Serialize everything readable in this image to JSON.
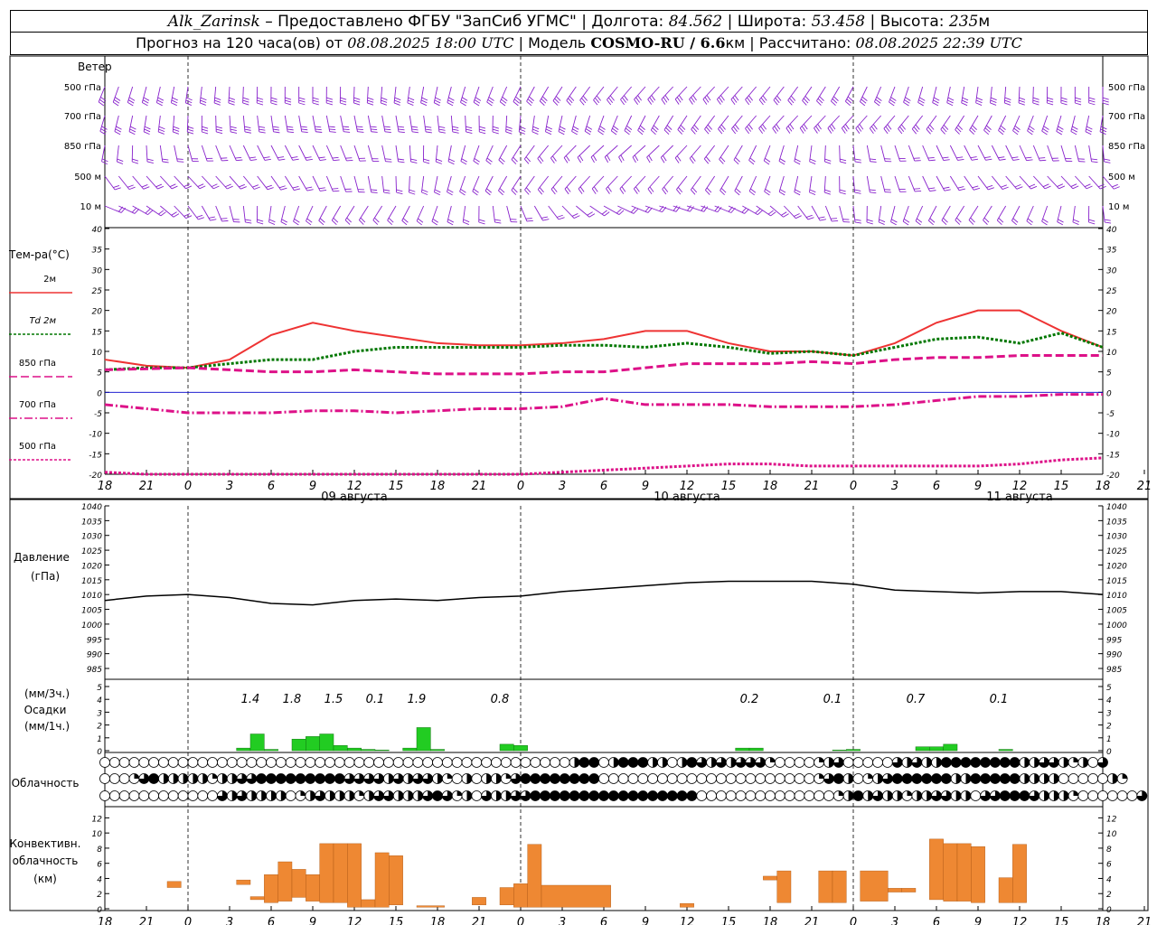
{
  "header": {
    "station": "Alk_Zarinsk",
    "provider": "– Предоставлено ФГБУ \"ЗапСиб УГМС\"",
    "lon_label": "Долгота:",
    "lon": "84.562",
    "lat_label": "Широта:",
    "lat": "53.458",
    "alt_label": "Высота:",
    "alt": "235",
    "alt_unit": "м",
    "forecast_label": "Прогноз на 120 часа(ов) от",
    "forecast_time": "08.08.2025 18:00 UTC",
    "model_label": "Модель",
    "model": "COSMO-RU / 6.6",
    "model_unit": "км",
    "calc_label": "Рассчитано:",
    "calc_time": "08.08.2025 22:39 UTC"
  },
  "colors": {
    "t2m": "#ee3333",
    "td2m": "#007700",
    "t850": "#dd1188",
    "t700": "#dd1188",
    "t500": "#dd1188",
    "wind": "#8822cc",
    "precip": "#22cc22",
    "convective": "#ee8833",
    "pressure": "#000000",
    "zero_line": "#0000cc"
  },
  "wind_panel": {
    "title": "Ветер",
    "levels": [
      "500 гПа",
      "700 гПа",
      "850 гПа",
      "500 м",
      "10 м"
    ]
  },
  "time_axis": {
    "tick_labels": [
      "18",
      "21",
      "0",
      "3",
      "6",
      "9",
      "12",
      "15",
      "18",
      "21",
      "0",
      "3",
      "6",
      "9",
      "12",
      "15",
      "18",
      "21",
      "0",
      "3",
      "6",
      "9",
      "12",
      "15",
      "18",
      "21",
      "0"
    ],
    "day_labels": [
      "09 августа",
      "10 августа",
      "11 августа"
    ]
  },
  "temp_panel": {
    "title": "Тем-ра(°С)",
    "legend": [
      "2м",
      "Td  2м",
      "850 гПа",
      "700 гПа",
      "500 гПа"
    ],
    "ticks": [
      "40",
      "35",
      "30",
      "25",
      "20",
      "15",
      "10",
      "5",
      "0",
      "-5",
      "-10",
      "-15",
      "-20"
    ]
  },
  "pressure_panel": {
    "title": "Давление",
    "unit": "(гПа)",
    "ticks": [
      "1040",
      "1035",
      "1030",
      "1025",
      "1020",
      "1015",
      "1010",
      "1005",
      "1000",
      "995",
      "990",
      "985"
    ]
  },
  "precip_panel": {
    "unit3": "(мм/3ч.)",
    "title": "Осадки",
    "unit1": "(мм/1ч.)",
    "ticks": [
      "5",
      "4",
      "3",
      "2",
      "1",
      "0"
    ],
    "totals_3h": [
      {
        "h": 10.5,
        "label": "1.4"
      },
      {
        "h": 13.5,
        "label": "1.8"
      },
      {
        "h": 16.5,
        "label": "1.5"
      },
      {
        "h": 19.5,
        "label": "0.1"
      },
      {
        "h": 22.5,
        "label": "1.9"
      },
      {
        "h": 28.5,
        "label": "0.8"
      },
      {
        "h": 46.5,
        "label": "0.2"
      },
      {
        "h": 52.5,
        "label": "0.1"
      },
      {
        "h": 58.5,
        "label": "0.7"
      },
      {
        "h": 64.5,
        "label": "0.1"
      }
    ]
  },
  "cloud_panel": {
    "title": "Облачность"
  },
  "conv_panel": {
    "title1": "Конвективн.",
    "title2": "облачность",
    "unit": "(км)",
    "ticks": [
      "12",
      "10",
      "8",
      "6",
      "4",
      "2",
      "0"
    ]
  },
  "chart_data": [
    {
      "type": "line",
      "title": "Тем-ра(°С)",
      "x_unit": "hours from 08.08.2025 18:00 UTC",
      "ylim": [
        -20,
        40
      ],
      "series": [
        {
          "name": "2м",
          "x": [
            0,
            3,
            6,
            9,
            12,
            15,
            18,
            21,
            24,
            27,
            30,
            33,
            36,
            39,
            42,
            45,
            48,
            51,
            54,
            57,
            60,
            63,
            66,
            69,
            72
          ],
          "values": [
            8,
            6.5,
            6,
            8,
            14,
            17,
            15,
            13.5,
            12,
            11.5,
            11.5,
            12,
            13,
            15,
            15,
            12,
            10,
            10,
            9,
            12,
            17,
            20,
            20,
            15,
            11
          ]
        },
        {
          "name": "Td  2м",
          "x": [
            0,
            3,
            6,
            9,
            12,
            15,
            18,
            21,
            24,
            27,
            30,
            33,
            36,
            39,
            42,
            45,
            48,
            51,
            54,
            57,
            60,
            63,
            66,
            69,
            72
          ],
          "values": [
            5.5,
            6,
            6,
            7,
            8,
            8,
            10,
            11,
            11,
            11,
            11,
            11.5,
            11.5,
            11,
            12,
            11,
            9.5,
            10,
            9,
            11,
            13,
            13.5,
            12,
            14.5,
            11
          ]
        },
        {
          "name": "850 гПа",
          "x": [
            0,
            6,
            9,
            12,
            15,
            18,
            21,
            24,
            27,
            30,
            33,
            36,
            39,
            42,
            45,
            48,
            51,
            54,
            57,
            60,
            63,
            66,
            69,
            72
          ],
          "values": [
            5.5,
            6,
            5.5,
            5,
            5,
            5.5,
            5,
            4.5,
            4.5,
            4.5,
            5,
            5,
            6,
            7,
            7,
            7,
            7.5,
            7,
            8,
            8.5,
            8.5,
            9,
            9,
            9
          ]
        },
        {
          "name": "700 гПа",
          "x": [
            0,
            3,
            6,
            9,
            12,
            15,
            18,
            21,
            24,
            27,
            30,
            33,
            36,
            39,
            42,
            45,
            48,
            51,
            54,
            57,
            60,
            63,
            66,
            69,
            72
          ],
          "values": [
            -3,
            -4,
            -5,
            -5,
            -5,
            -4.5,
            -4.5,
            -5,
            -4.5,
            -4,
            -4,
            -3.5,
            -1.5,
            -3,
            -3,
            -3,
            -3.5,
            -3.5,
            -3.5,
            -3,
            -2,
            -1,
            -1,
            -0.5,
            -0.5
          ]
        },
        {
          "name": "500 гПа",
          "x": [
            0,
            3,
            30,
            33,
            36,
            39,
            42,
            45,
            48,
            51,
            54,
            57,
            60,
            63,
            66,
            69,
            72
          ],
          "values": [
            -19.5,
            -20,
            -20,
            -19.5,
            -19,
            -18.5,
            -18,
            -17.5,
            -17.5,
            -18,
            -18,
            -18,
            -18,
            -18,
            -17.5,
            -16.5,
            -16
          ]
        }
      ]
    },
    {
      "type": "line",
      "title": "Давление",
      "ylim": [
        985,
        1040
      ],
      "series": [
        {
          "name": "Давление",
          "x": [
            0,
            3,
            6,
            9,
            12,
            15,
            18,
            21,
            24,
            27,
            30,
            33,
            36,
            39,
            42,
            45,
            48,
            51,
            54,
            57,
            60,
            63,
            66,
            69,
            72
          ],
          "values": [
            1008,
            1009.5,
            1010,
            1009,
            1007,
            1006.5,
            1008,
            1008.5,
            1008,
            1009,
            1009.5,
            1011,
            1012,
            1013,
            1014,
            1014.5,
            1014.5,
            1014.5,
            1013.5,
            1011.5,
            1011,
            1010.5,
            1011,
            1011,
            1010
          ]
        }
      ]
    },
    {
      "type": "bar",
      "title": "Осадки",
      "unit": "мм/1ч.",
      "ylim": [
        0,
        5
      ],
      "x": [
        10,
        11,
        12,
        14,
        15,
        16,
        17,
        18,
        19,
        20,
        22,
        23,
        24,
        29,
        30,
        46,
        47,
        53,
        54,
        59,
        60,
        61,
        65
      ],
      "values": [
        0.2,
        1.3,
        0.1,
        0.9,
        1.1,
        1.3,
        0.4,
        0.2,
        0.1,
        0.05,
        0.2,
        1.8,
        0.1,
        0.5,
        0.4,
        0.2,
        0.2,
        0.05,
        0.1,
        0.3,
        0.3,
        0.5,
        0.1
      ]
    },
    {
      "type": "bar",
      "title": "Конвективн. облачность",
      "unit": "км",
      "ylim": [
        0,
        13
      ],
      "bars": [
        {
          "x": 5,
          "w": 1,
          "bottom": 2.8,
          "top": 3.6
        },
        {
          "x": 10,
          "w": 1,
          "bottom": 3.2,
          "top": 3.8
        },
        {
          "x": 11,
          "w": 1,
          "bottom": 1.2,
          "top": 1.6
        },
        {
          "x": 12,
          "w": 1,
          "bottom": 0.8,
          "top": 4.5
        },
        {
          "x": 13,
          "w": 1,
          "bottom": 1.0,
          "top": 6.2
        },
        {
          "x": 14,
          "w": 1,
          "bottom": 1.5,
          "top": 5.2
        },
        {
          "x": 15,
          "w": 1,
          "bottom": 1.0,
          "top": 4.5
        },
        {
          "x": 16,
          "w": 1,
          "bottom": 0.8,
          "top": 8.6
        },
        {
          "x": 17,
          "w": 1,
          "bottom": 0.8,
          "top": 8.6
        },
        {
          "x": 18,
          "w": 1,
          "bottom": 0.2,
          "top": 8.6
        },
        {
          "x": 19,
          "w": 1,
          "bottom": 0.2,
          "top": 1.2
        },
        {
          "x": 20,
          "w": 1,
          "bottom": 0.2,
          "top": 7.4
        },
        {
          "x": 21,
          "w": 1,
          "bottom": 0.5,
          "top": 7.0
        },
        {
          "x": 23,
          "w": 2,
          "bottom": 0.2,
          "top": 0.4
        },
        {
          "x": 27,
          "w": 1,
          "bottom": 0.5,
          "top": 1.5
        },
        {
          "x": 29,
          "w": 1,
          "bottom": 0.5,
          "top": 2.8
        },
        {
          "x": 30,
          "w": 1,
          "bottom": 0.2,
          "top": 3.3
        },
        {
          "x": 31,
          "w": 1,
          "bottom": 0.2,
          "top": 8.5
        },
        {
          "x": 32,
          "w": 5,
          "bottom": 0.2,
          "top": 3.1
        },
        {
          "x": 42,
          "w": 1,
          "bottom": 0.2,
          "top": 0.7
        },
        {
          "x": 48,
          "w": 1,
          "bottom": 3.8,
          "top": 4.3
        },
        {
          "x": 49,
          "w": 1,
          "bottom": 0.8,
          "top": 5.0
        },
        {
          "x": 52,
          "w": 1,
          "bottom": 0.8,
          "top": 5.0
        },
        {
          "x": 53,
          "w": 1,
          "bottom": 0.8,
          "top": 5.0
        },
        {
          "x": 55,
          "w": 2,
          "bottom": 1.0,
          "top": 5.0
        },
        {
          "x": 57,
          "w": 1,
          "bottom": 2.2,
          "top": 2.7
        },
        {
          "x": 58,
          "w": 1,
          "bottom": 2.2,
          "top": 2.7
        },
        {
          "x": 60,
          "w": 1,
          "bottom": 1.2,
          "top": 9.2
        },
        {
          "x": 61,
          "w": 1,
          "bottom": 1.0,
          "top": 8.6
        },
        {
          "x": 62,
          "w": 1,
          "bottom": 1.0,
          "top": 8.6
        },
        {
          "x": 63,
          "w": 1,
          "bottom": 0.8,
          "top": 8.2
        },
        {
          "x": 65,
          "w": 1,
          "bottom": 0.8,
          "top": 4.1
        },
        {
          "x": 66,
          "w": 1,
          "bottom": 0.8,
          "top": 8.5
        }
      ]
    },
    {
      "type": "table",
      "title": "Облачность",
      "note": "cloud cover per hour in oktas-like fraction 0..1, rows: upper, middle, lower",
      "rows": [
        [
          0,
          0,
          0,
          0,
          0,
          0,
          0,
          0,
          0,
          0,
          0,
          0,
          0,
          0,
          0,
          0,
          0,
          0,
          0,
          0,
          0,
          0,
          0,
          0,
          0,
          0,
          0,
          0,
          0,
          0,
          0,
          0,
          0,
          0,
          0,
          0,
          0,
          0,
          0,
          0,
          0,
          0,
          0,
          0,
          0,
          0,
          0,
          0,
          0.5,
          1,
          1,
          0,
          0.5,
          1,
          1,
          1,
          0.5,
          0.5,
          0,
          0.5,
          1,
          0.75,
          0.5,
          0.75,
          0.5,
          0.75,
          0.75,
          0.75,
          0.25,
          0,
          0,
          0,
          0,
          0.25,
          0.5,
          0.75,
          0,
          0,
          0,
          0,
          0,
          0.75,
          0.5,
          0.75,
          0.5,
          0.5,
          1,
          1,
          1,
          1,
          1,
          1,
          1,
          1,
          0.5,
          0.5,
          0.75,
          0.75,
          0.5,
          0.25,
          0.5,
          0,
          0.75
        ],
        [
          0,
          0,
          0,
          0.25,
          0.75,
          1,
          0.5,
          0.5,
          0.5,
          0.5,
          0.5,
          0.25,
          0.5,
          0.5,
          0.75,
          0.75,
          1,
          1,
          1,
          1,
          1,
          1,
          1,
          1,
          1,
          0.75,
          0.75,
          0.75,
          0.75,
          0.5,
          0.75,
          0.5,
          0.75,
          0.75,
          0.5,
          0.25,
          0,
          0.5,
          0,
          0.5,
          0.5,
          0.25,
          0.75,
          1,
          1,
          1,
          1,
          1,
          1,
          1,
          1,
          0,
          0,
          0,
          0,
          0,
          0,
          0,
          0,
          0,
          0,
          0,
          0,
          0,
          0,
          0,
          0,
          0,
          0,
          0,
          0,
          0,
          0,
          0.25,
          0.75,
          1,
          0.5,
          0,
          0.25,
          0.5,
          0.75,
          1,
          1,
          1,
          1,
          1,
          1,
          0.5,
          0.5,
          1,
          1,
          1,
          1,
          1,
          0.5,
          0.5,
          0.5,
          0.5,
          0,
          0,
          0,
          0,
          0,
          0.5,
          0.25
        ],
        [
          0,
          0,
          0,
          0,
          0,
          0,
          0,
          0,
          0,
          0,
          0,
          0,
          0.75,
          0.5,
          0.75,
          0.5,
          0.5,
          0.5,
          0.5,
          0,
          0.25,
          0.5,
          0.75,
          0.5,
          0.5,
          0.5,
          0.25,
          0.5,
          0.75,
          0.75,
          0.5,
          0.5,
          0.5,
          0.75,
          1,
          0.75,
          0.25,
          0.5,
          0,
          0.75,
          0.5,
          0.5,
          0.75,
          0.75,
          1,
          1,
          1,
          1,
          1,
          1,
          1,
          1,
          1,
          1,
          1,
          1,
          1,
          1,
          1,
          1,
          1,
          0,
          0,
          0,
          0,
          0,
          0,
          0,
          0,
          0,
          0,
          0,
          0,
          0,
          0,
          0.25,
          0.5,
          1,
          0.5,
          0.75,
          0.5,
          0.5,
          0.25,
          0.5,
          0.5,
          0.75,
          0.75,
          0.5,
          0.5,
          0,
          0.75,
          0.75,
          1,
          1,
          1,
          0.75,
          0.5,
          0.5,
          0.5,
          0.25,
          0,
          0,
          0,
          0,
          0,
          0,
          0.75
        ]
      ]
    }
  ]
}
